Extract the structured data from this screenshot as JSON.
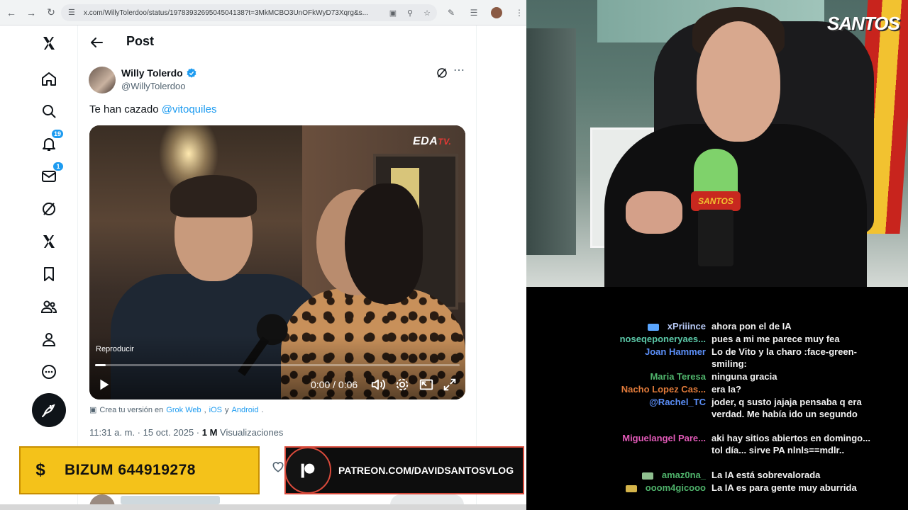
{
  "browser": {
    "url": "x.com/WillyTolerdoo/status/1978393269504504138?t=3MkMCBO3UnOFkWyD73Xqrg&s..."
  },
  "xnav": {
    "notifications_badge": "19",
    "messages_badge": "1"
  },
  "post": {
    "header_title": "Post",
    "author_name": "Willy Tolerdo",
    "author_handle": "@WillyTolerdoo",
    "text_prefix": "Te han cazado ",
    "text_mention": "@vitoquiles",
    "video": {
      "watermark_main": "EDA",
      "watermark_suffix": "TV.",
      "play_label": "Reproducir",
      "time": "0:00 / 0:06",
      "progress": 0.03
    },
    "grok_prefix": "Crea tu versión en ",
    "grok_web": "Grok Web",
    "grok_sep1": ", ",
    "grok_ios": "iOS",
    "grok_sep2": " y ",
    "grok_android": "Android",
    "grok_end": ".",
    "timestamp": "11:31 a. m. · 15 oct. 2025 · ",
    "views_count": "1 M",
    "views_label": " Visualizaciones"
  },
  "overlays": {
    "bizum_symbol": "$",
    "bizum_text": "BIZUM 644919278",
    "patreon_text": "PATREON.COM/DAVIDSANTOSVLOG"
  },
  "webcam": {
    "channel_logo": "SANTOS",
    "mic_label": "SANTOS"
  },
  "chat": {
    "messages": [
      {
        "user": "xPriiince",
        "color": "#b7c9f5",
        "badge": "#5aa6ff",
        "text": "ahora pon el de IA"
      },
      {
        "user": "noseqeponeryaes...",
        "color": "#5bc8a8",
        "badge": "",
        "text": "pues a mi me parece muy fea"
      },
      {
        "user": "Joan Hammer",
        "color": "#5b8ff9",
        "badge": "",
        "text": "Lo de Vito y la charo :face-green-smiling:"
      },
      {
        "user": "Maria Teresa",
        "color": "#4fb36b",
        "badge": "",
        "text": "ninguna gracia"
      },
      {
        "user": "Nacho Lopez Cas...",
        "color": "#e07a3a",
        "badge": "",
        "text": "era Ia?"
      },
      {
        "user": "@Rachel_TC",
        "color": "#5b8ff9",
        "badge": "",
        "text": "joder, q susto jajaja pensaba q era verdad. Me había ido un segundo"
      },
      {
        "user": "Miguelangel Pare...",
        "color": "#e25ab8",
        "badge": "",
        "text": "aki hay sitios abiertos en domingo... tol día... sirve PA nlnls==mdlr.."
      },
      {
        "user": "amaz0na_",
        "color": "#4fb36b",
        "badge": "#8fbf8f",
        "text": "La IA está sobrevalorada"
      },
      {
        "user": "ooom4gicooo",
        "color": "#4fb36b",
        "badge": "#d4b44a",
        "text": "La IA es para gente muy aburrida"
      }
    ]
  }
}
